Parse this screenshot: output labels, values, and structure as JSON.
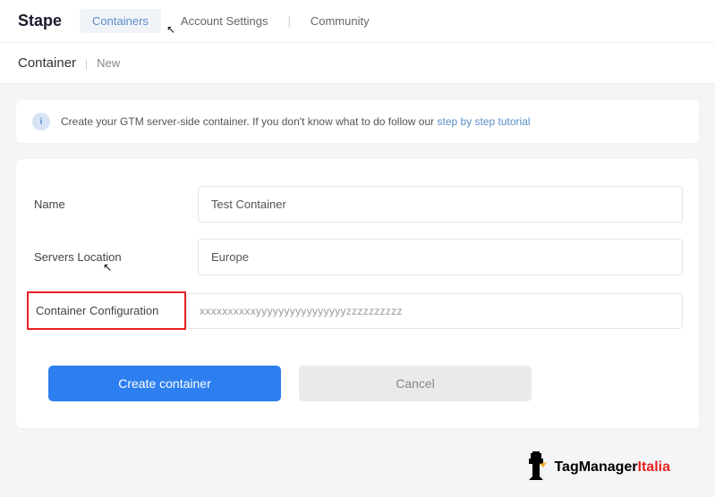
{
  "header": {
    "logo": "Stape",
    "nav": {
      "containers": "Containers",
      "account_settings": "Account Settings",
      "community": "Community"
    }
  },
  "breadcrumb": {
    "main": "Container",
    "sub": "New"
  },
  "info": {
    "text_prefix": "Create your GTM server-side container. If you don't know what to do follow our ",
    "link_text": "step by step tutorial"
  },
  "form": {
    "name_label": "Name",
    "name_value": "Test Container",
    "location_label": "Servers Location",
    "location_value": "Europe",
    "config_label": "Container Configuration",
    "config_value": "xxxxxxxxxxyyyyyyyyyyyyyyyyzzzzzzzzzz"
  },
  "buttons": {
    "create": "Create container",
    "cancel": "Cancel"
  },
  "footer": {
    "brand_main": "TagManager",
    "brand_accent": "Italia"
  }
}
